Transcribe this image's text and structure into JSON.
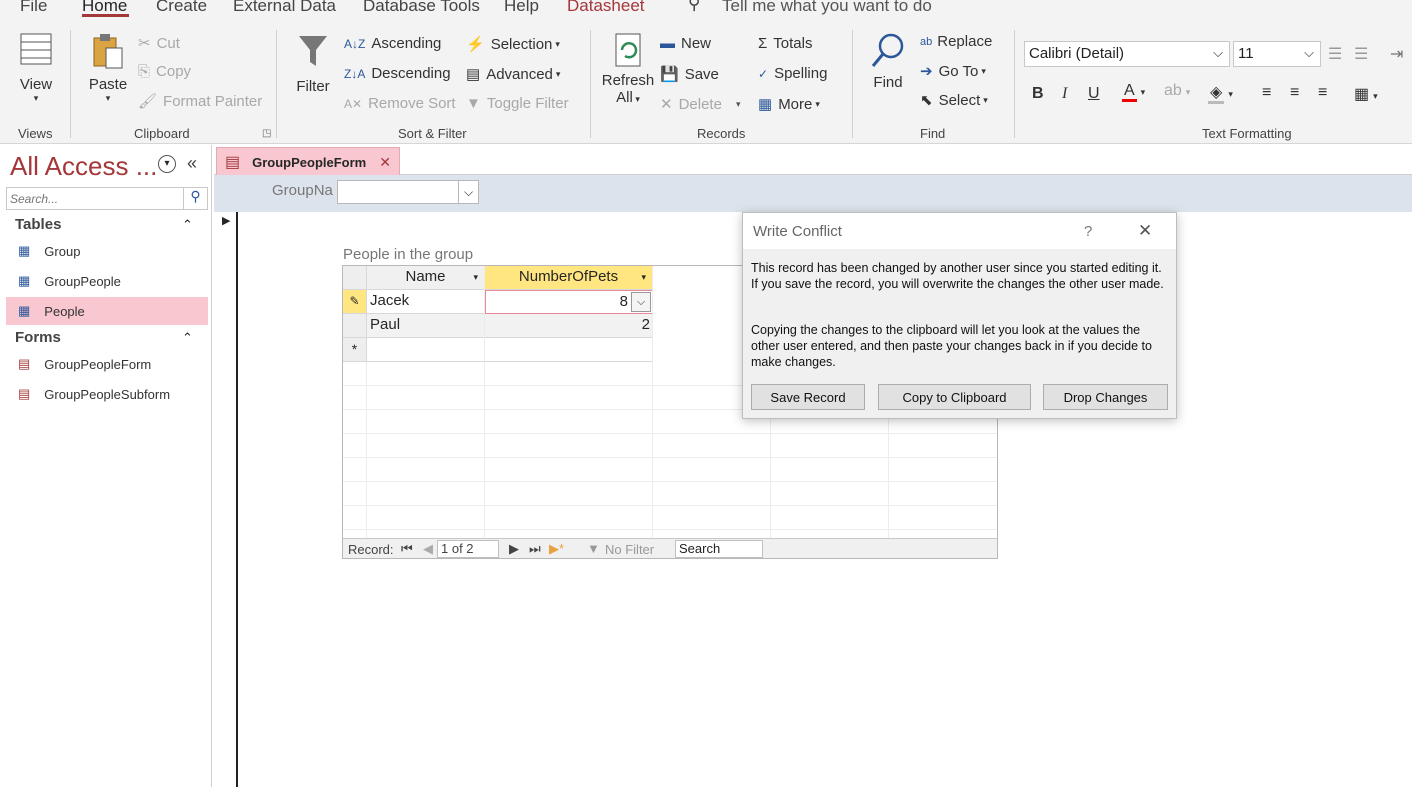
{
  "menu": {
    "tabs": [
      "File",
      "Home",
      "Create",
      "External Data",
      "Database Tools",
      "Help",
      "Datasheet"
    ],
    "tell_me": "Tell me what you want to do"
  },
  "ribbon": {
    "views": {
      "view": "View",
      "label": "Views"
    },
    "clipboard": {
      "paste": "Paste",
      "cut": "Cut",
      "copy": "Copy",
      "format_painter": "Format Painter",
      "label": "Clipboard"
    },
    "sort_filter": {
      "filter": "Filter",
      "ascending": "Ascending",
      "descending": "Descending",
      "remove_sort": "Remove Sort",
      "selection": "Selection",
      "advanced": "Advanced",
      "toggle_filter": "Toggle Filter",
      "label": "Sort & Filter"
    },
    "records": {
      "refresh": "Refresh",
      "refresh_all": "All",
      "new": "New",
      "save": "Save",
      "delete": "Delete",
      "totals": "Totals",
      "spelling": "Spelling",
      "more": "More",
      "label": "Records"
    },
    "find": {
      "find": "Find",
      "replace": "Replace",
      "goto": "Go To",
      "select": "Select",
      "label": "Find"
    },
    "text_formatting": {
      "font": "Calibri (Detail)",
      "size": "11",
      "bold": "B",
      "italic": "I",
      "underline": "U",
      "label": "Text Formatting"
    }
  },
  "nav": {
    "title": "All Access ...",
    "search_placeholder": "Search...",
    "tables_header": "Tables",
    "tables": [
      "Group",
      "GroupPeople",
      "People"
    ],
    "forms_header": "Forms",
    "forms": [
      "GroupPeopleForm",
      "GroupPeopleSubform"
    ]
  },
  "document": {
    "tab_title": "GroupPeopleForm",
    "group_name_label": "GroupNa",
    "subform_label": "People in the group",
    "columns": [
      "Name",
      "NumberOfPets"
    ],
    "rows": [
      {
        "name": "Jacek",
        "pets": "8"
      },
      {
        "name": "Paul",
        "pets": "2"
      }
    ],
    "nav_bar": {
      "record_label": "Record:",
      "position": "1 of 2",
      "filter": "No Filter",
      "search": "Search"
    }
  },
  "dialog": {
    "title": "Write Conflict",
    "help": "?",
    "message1": "This record has been changed by another user since you started editing it.  If you save the record, you will overwrite the changes the other user made.",
    "message2": "Copying the changes to the clipboard will let you look at the values the other user entered, and then paste your changes back in if you decide to make changes.",
    "save_button": "Save Record",
    "copy_button": "Copy to Clipboard",
    "drop_button": "Drop Changes"
  },
  "colors": {
    "accent": "#a4373a",
    "selection": "#f8c7cf",
    "active_header": "#ffe680"
  }
}
